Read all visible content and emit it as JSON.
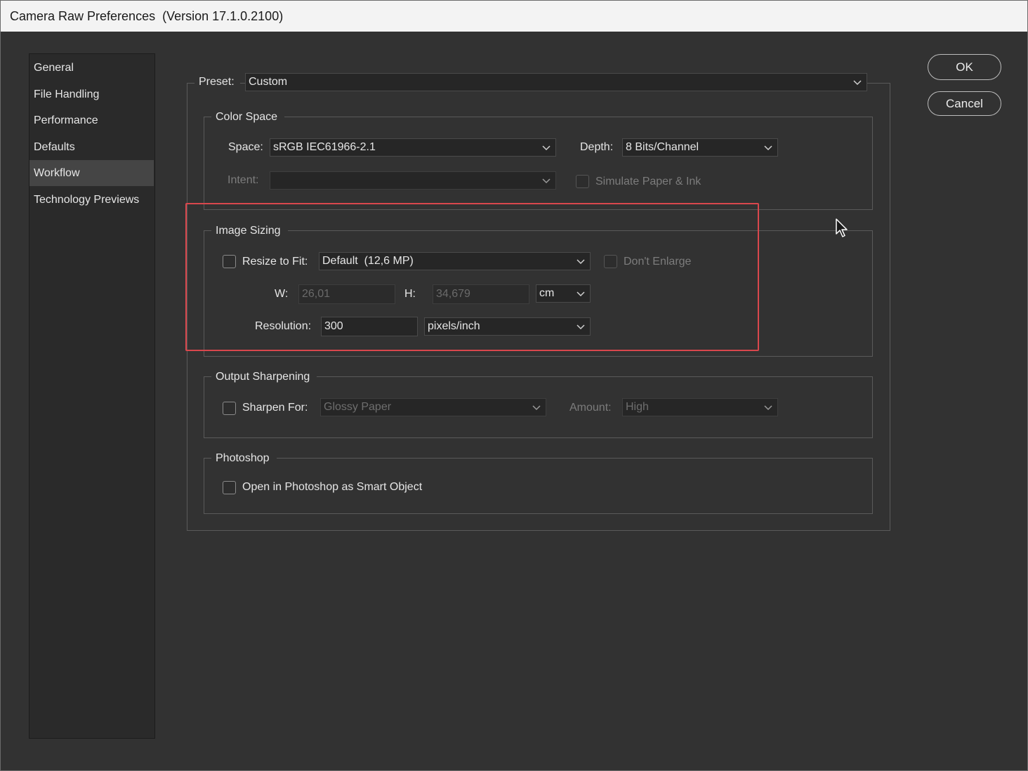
{
  "window": {
    "title": "Camera Raw Preferences  (Version 17.1.0.2100)"
  },
  "sidebar": {
    "items": [
      {
        "label": "General"
      },
      {
        "label": "File Handling"
      },
      {
        "label": "Performance"
      },
      {
        "label": "Defaults"
      },
      {
        "label": "Workflow",
        "selected": true
      },
      {
        "label": "Technology Previews"
      }
    ]
  },
  "buttons": {
    "ok": "OK",
    "cancel": "Cancel"
  },
  "preset": {
    "label": "Preset:",
    "value": "Custom"
  },
  "color_space": {
    "legend": "Color Space",
    "space_label": "Space:",
    "space_value": "sRGB IEC61966-2.1",
    "depth_label": "Depth:",
    "depth_value": "8 Bits/Channel",
    "intent_label": "Intent:",
    "intent_value": "",
    "simulate_label": "Simulate Paper & Ink",
    "simulate_checked": false
  },
  "image_sizing": {
    "legend": "Image Sizing",
    "resize_label": "Resize to Fit:",
    "resize_checked": false,
    "resize_value": "Default  (12,6 MP)",
    "dont_enlarge_label": "Don't Enlarge",
    "dont_enlarge_checked": false,
    "w_label": "W:",
    "w_value": "26,01",
    "h_label": "H:",
    "h_value": "34,679",
    "unit_value": "cm",
    "resolution_label": "Resolution:",
    "resolution_value": "300",
    "resolution_unit": "pixels/inch"
  },
  "output_sharpening": {
    "legend": "Output Sharpening",
    "sharpen_label": "Sharpen For:",
    "sharpen_checked": false,
    "sharpen_value": "Glossy Paper",
    "amount_label": "Amount:",
    "amount_value": "High"
  },
  "photoshop": {
    "legend": "Photoshop",
    "smart_object_label": "Open in Photoshop as Smart Object",
    "smart_object_checked": false
  },
  "colors": {
    "background": "#323232",
    "sidebar": "#2a2a2a",
    "highlight": "#d9474d"
  }
}
